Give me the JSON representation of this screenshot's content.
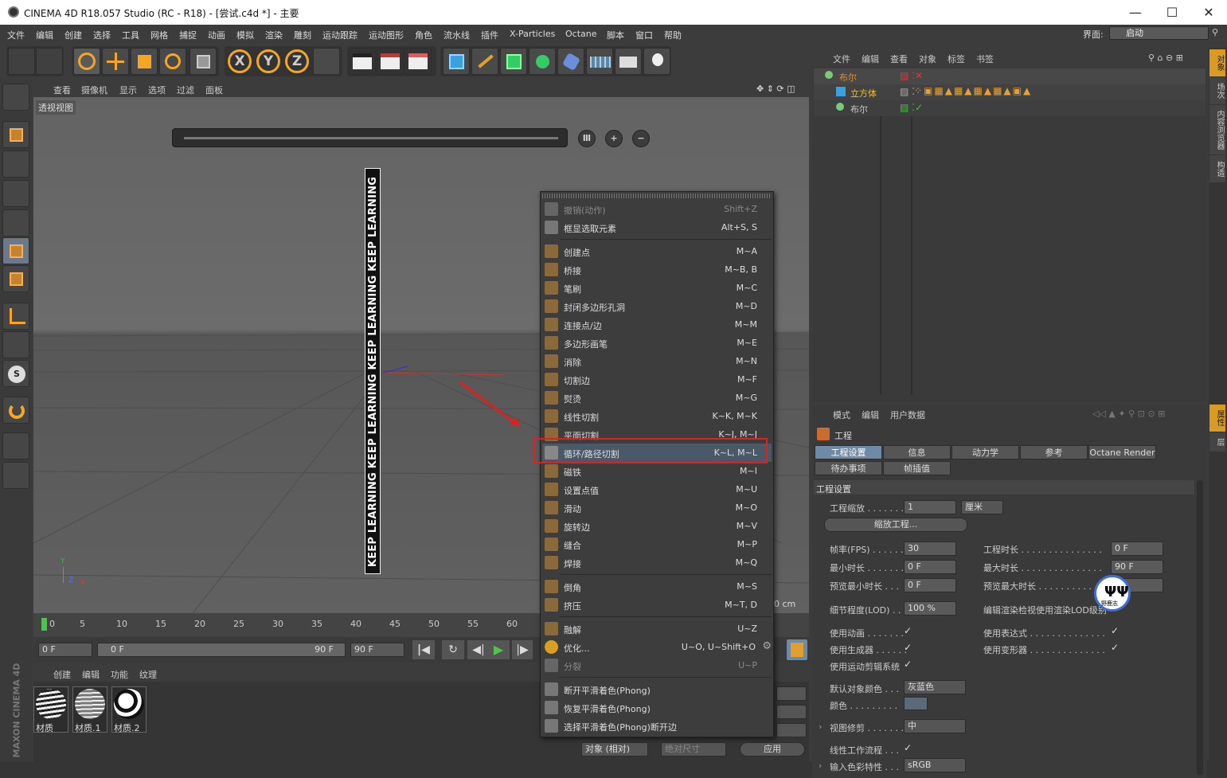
{
  "window": {
    "title": "CINEMA 4D R18.057 Studio (RC - R18) - [尝试.c4d *] - 主要",
    "minimize": "—",
    "maximize": "☐",
    "close": "✕"
  },
  "menu": [
    "文件",
    "编辑",
    "创建",
    "选择",
    "工具",
    "网格",
    "捕捉",
    "动画",
    "模拟",
    "渲染",
    "雕刻",
    "运动跟踪",
    "运动图形",
    "角色",
    "流水线",
    "插件",
    "X-Particles",
    "Octane",
    "脚本",
    "窗口",
    "帮助"
  ],
  "layout": {
    "label": "界面:",
    "value": "启动"
  },
  "viewport": {
    "menu": [
      "查看",
      "摄像机",
      "显示",
      "选项",
      "过滤",
      "面板"
    ],
    "label": "透视视图",
    "pole_text": "KEEP LEARNING KEEP LEARNING KEEP LEARNING KEEP LEARNING",
    "axis_y": "Y",
    "axis_z": "Z",
    "axis_x": "X",
    "distance": "0 cm"
  },
  "timeline": {
    "ticks": [
      "0",
      "5",
      "10",
      "15",
      "20",
      "25",
      "30",
      "35",
      "40",
      "45",
      "50",
      "55",
      "60"
    ],
    "current_frame": "0 F",
    "start_field": "0 F",
    "range_left": "0 F",
    "range_right": "90 F",
    "end_field": "90 F"
  },
  "material_manager": {
    "menu": [
      "创建",
      "编辑",
      "功能",
      "纹理"
    ],
    "materials": [
      "材质",
      "材质.1",
      "材质.2"
    ]
  },
  "branding": "MAXON CINEMA 4D",
  "coord_bar": {
    "mode": "对象 (相对)",
    "size": "绝对尺寸",
    "apply": "应用"
  },
  "context_menu": {
    "items": [
      {
        "label": "撤销(动作)",
        "shortcut": "Shift+Z",
        "disabled": true
      },
      {
        "label": "框显选取元素",
        "shortcut": "Alt+S, S"
      },
      {
        "label": "创建点",
        "shortcut": "M~A"
      },
      {
        "label": "桥接",
        "shortcut": "M~B, B"
      },
      {
        "label": "笔刷",
        "shortcut": "M~C"
      },
      {
        "label": "封闭多边形孔洞",
        "shortcut": "M~D"
      },
      {
        "label": "连接点/边",
        "shortcut": "M~M"
      },
      {
        "label": "多边形画笔",
        "shortcut": "M~E"
      },
      {
        "label": "消除",
        "shortcut": "M~N"
      },
      {
        "label": "切割边",
        "shortcut": "M~F"
      },
      {
        "label": "熨烫",
        "shortcut": "M~G"
      },
      {
        "label": "线性切割",
        "shortcut": "K~K, M~K"
      },
      {
        "label": "平面切割",
        "shortcut": "K~J, M~J"
      },
      {
        "label": "循环/路径切割",
        "shortcut": "K~L, M~L"
      },
      {
        "label": "磁铁",
        "shortcut": "M~I"
      },
      {
        "label": "设置点值",
        "shortcut": "M~U"
      },
      {
        "label": "滑动",
        "shortcut": "M~O"
      },
      {
        "label": "旋转边",
        "shortcut": "M~V"
      },
      {
        "label": "缝合",
        "shortcut": "M~P"
      },
      {
        "label": "焊接",
        "shortcut": "M~Q"
      },
      {
        "label": "倒角",
        "shortcut": "M~S"
      },
      {
        "label": "挤压",
        "shortcut": "M~T, D"
      },
      {
        "label": "融解",
        "shortcut": "U~Z"
      },
      {
        "label": "优化...",
        "shortcut": "U~O, U~Shift+O"
      },
      {
        "label": "分裂",
        "shortcut": "U~P",
        "disabled": true
      },
      {
        "label": "断开平滑着色(Phong)",
        "shortcut": ""
      },
      {
        "label": "恢复平滑着色(Phong)",
        "shortcut": ""
      },
      {
        "label": "选择平滑着色(Phong)断开边",
        "shortcut": ""
      }
    ]
  },
  "object_manager": {
    "menu": [
      "文件",
      "编辑",
      "查看",
      "对象",
      "标签",
      "书签"
    ],
    "rows": [
      {
        "name": "布尔"
      },
      {
        "name": "立方体"
      },
      {
        "name": "布尔"
      }
    ]
  },
  "attribute_manager": {
    "menu": [
      "模式",
      "编辑",
      "用户数据"
    ],
    "header": "工程",
    "tabs": [
      "工程设置",
      "信息",
      "动力学",
      "参考",
      "Octane Render",
      "待办事项",
      "帧插值"
    ],
    "section": "工程设置",
    "project_scale_label": "工程缩放 . . . . . . .",
    "project_scale_value": "1",
    "project_scale_unit": "厘米",
    "scale_project_btn": "缩放工程...",
    "fps_label": "帧率(FPS) . . . . . .",
    "fps_value": "30",
    "project_length_label": "工程时长 . . . . . . . . . . . . . . .",
    "project_length_value": "0 F",
    "min_time_label": "最小时长 . . . . . . .",
    "min_time_value": "0 F",
    "max_time_label": "最大时长 . . . . . . . . . . . . . . .",
    "max_time_value": "90 F",
    "prev_min_label": "预览最小时长 . . .",
    "prev_min_value": "0 F",
    "prev_max_label": "预览最大时长 . . . . . . . . . . . . .",
    "lod_label": "细节程度(LOD) . .",
    "lod_value": "100 %",
    "render_lod_label": "编辑渲染检视使用渲染LOD级别",
    "use_anim": "使用动画 . . . . . . .",
    "use_expr": "使用表达式 . . . . . . . . . . . . . .",
    "use_gen": "使用生成器 . . . . . .",
    "use_deform": "使用变形器 . . . . . . . . . . . . . .",
    "use_motion": "使用运动剪辑系统",
    "default_color_label": "默认对象颜色 . . .",
    "default_color_value": "灰蓝色",
    "color_label": "颜色 . . . . . . . . .",
    "view_clip_label": "视图修剪 . . . . . . .",
    "view_clip_value": "中",
    "linear_label": "线性工作流程 . . .",
    "input_color_label": "输入色彩特性 . . .",
    "input_color_value": "sRGB",
    "check": "✓"
  },
  "right_tabs": [
    "对象",
    "场次",
    "内容浏览器",
    "构造",
    "属性",
    "层"
  ],
  "watermark_text": "野鹿志"
}
